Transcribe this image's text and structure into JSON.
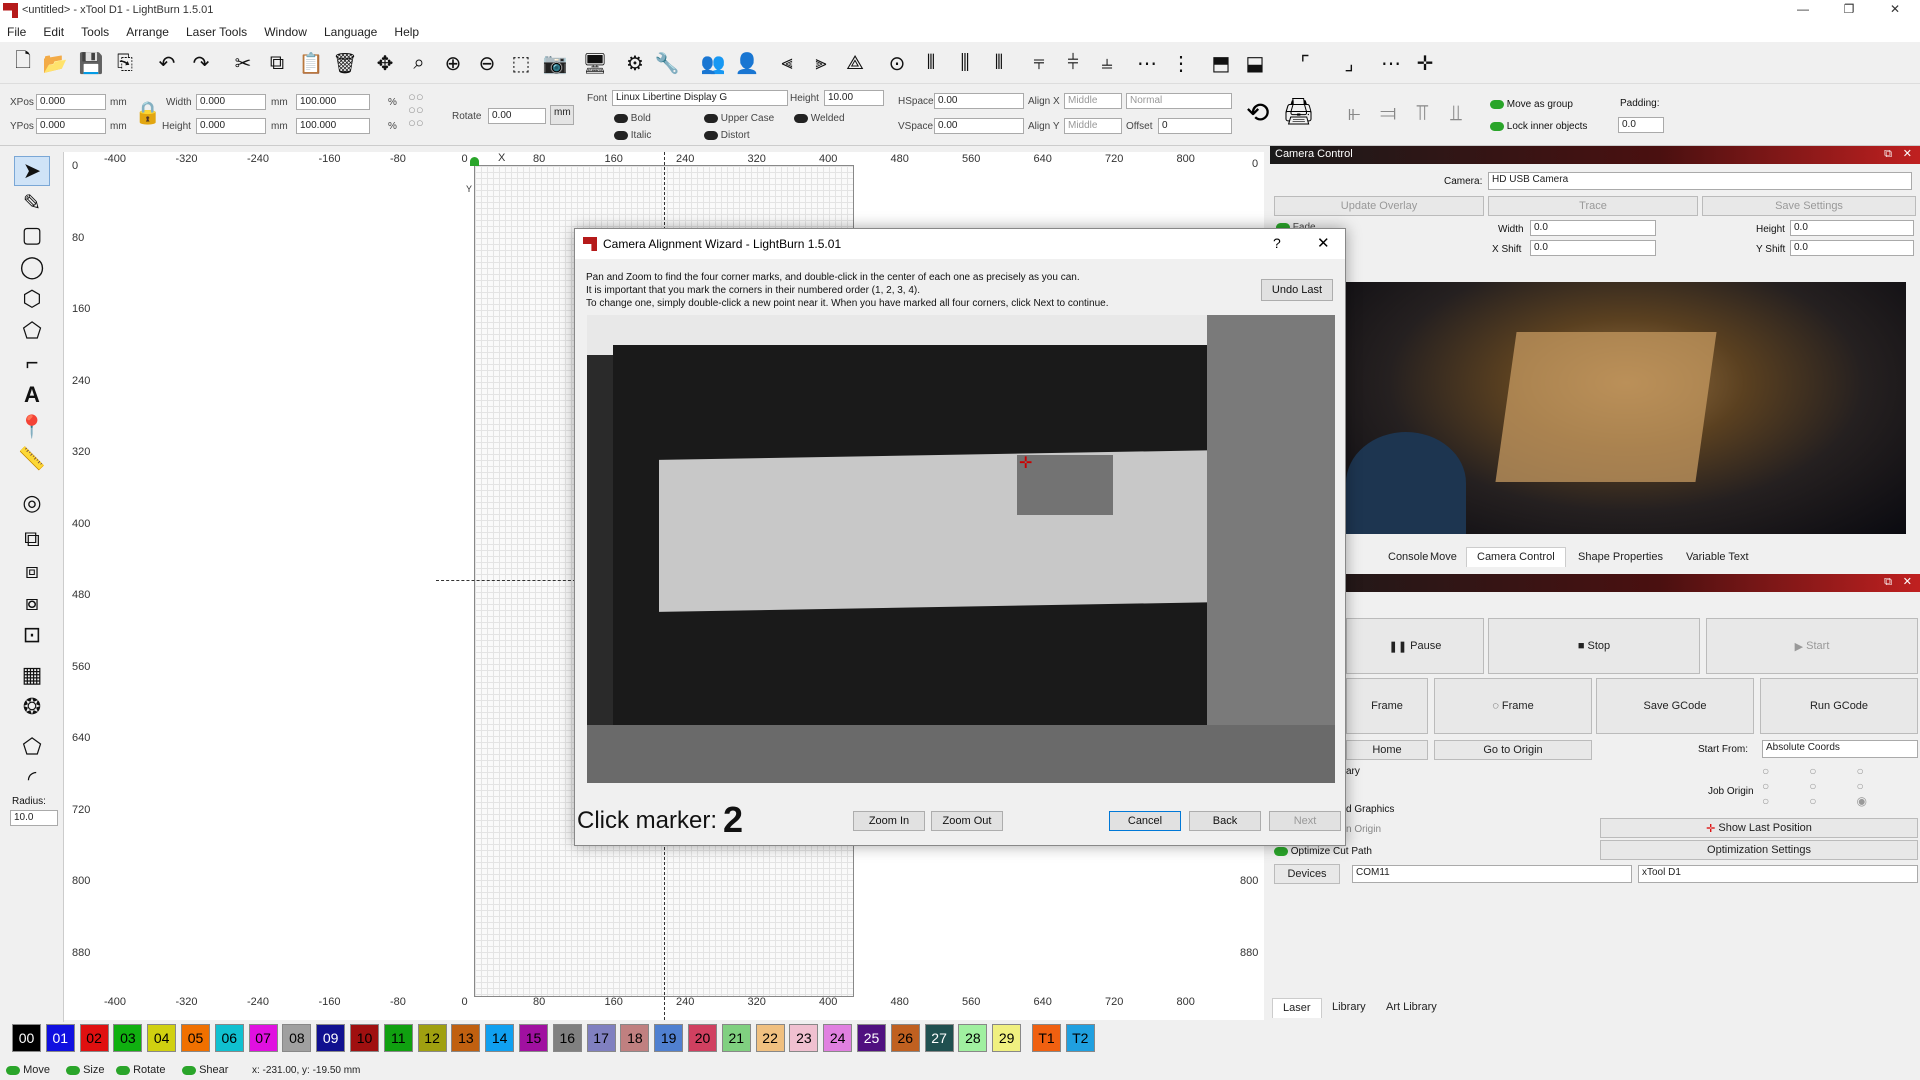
{
  "window": {
    "title": "<untitled> - xTool D1 - LightBurn 1.5.01",
    "minimize": "—",
    "restore": "❐",
    "close": "✕"
  },
  "menu": [
    "File",
    "Edit",
    "Tools",
    "Arrange",
    "Laser Tools",
    "Window",
    "Language",
    "Help"
  ],
  "props": {
    "xpos_label": "XPos",
    "xpos": "0.000",
    "ypos_label": "YPos",
    "ypos": "0.000",
    "unit": "mm",
    "width_label": "Width",
    "width": "0.000",
    "height_label": "Height",
    "height": "0.000",
    "scale_w": "100.000",
    "scale_h": "100.000",
    "pct": "%",
    "rotate_label": "Rotate",
    "rotate": "0.00",
    "mm_btn": "mm",
    "font_label": "Font",
    "font": "Linux Libertine Display G",
    "fheight_label": "Height",
    "fheight": "10.00",
    "hspace_label": "HSpace",
    "hspace": "0.00",
    "vspace_label": "VSpace",
    "vspace": "0.00",
    "alignx_label": "Align X",
    "alignx": "Middle",
    "aligny_label": "Align Y",
    "aligny": "Middle",
    "mode": "Normal",
    "offset_label": "Offset",
    "offset": "0",
    "bold": "Bold",
    "italic": "Italic",
    "upper": "Upper Case",
    "distort": "Distort",
    "welded": "Welded",
    "move_group": "Move as group",
    "lock_inner": "Lock inner objects",
    "padding_label": "Padding:",
    "padding": "0.0"
  },
  "left": {
    "radius_label": "Radius:",
    "radius": "10.0"
  },
  "rulers": {
    "top": [
      "-400",
      "-320",
      "-240",
      "-160",
      "-80",
      "0",
      "80",
      "160",
      "240",
      "320",
      "400",
      "480",
      "560",
      "640",
      "720",
      "800"
    ],
    "left": [
      "0",
      "80",
      "160",
      "240",
      "320",
      "400",
      "480",
      "560",
      "640",
      "720",
      "800",
      "880"
    ],
    "right": [
      "0",
      "800",
      "880"
    ],
    "x_axis": "X",
    "y_axis": "Y"
  },
  "camera": {
    "title": "Camera Control",
    "camera_label": "Camera:",
    "camera": "HD USB Camera",
    "update_overlay": "Update Overlay",
    "trace": "Trace",
    "save_settings": "Save Settings",
    "fade": "Fade",
    "width_label": "Width",
    "width": "0.0",
    "height_label": "Height",
    "height": "0.0",
    "xshift_label": "X Shift",
    "xshift": "0.0",
    "yshift_label": "Y Shift",
    "yshift": "0.0"
  },
  "tabs": [
    "Console",
    "Move",
    "Camera Control",
    "Shape Properties",
    "Variable Text"
  ],
  "laser": {
    "pause": "Pause",
    "stop": "Stop",
    "start": "Start",
    "frame1": "Frame",
    "frame2": "Frame",
    "save_gcode": "Save GCode",
    "run_gcode": "Run GCode",
    "home": "Home",
    "go_origin": "Go to Origin",
    "start_from_label": "Start From:",
    "start_from": "Absolute Coords",
    "ary": "ary",
    "job_origin": "Job Origin",
    "graphics": "d Graphics",
    "origin": "n Origin",
    "show_last": "Show Last Position",
    "opt_cut": "Optimize Cut Path",
    "opt_settings": "Optimization Settings",
    "devices": "Devices",
    "port": "COM11",
    "device": "xTool D1"
  },
  "bottom_tabs": [
    "Laser",
    "Library",
    "Art Library"
  ],
  "palette": [
    {
      "label": "00",
      "color": "#000000"
    },
    {
      "label": "01",
      "color": "#1010e0"
    },
    {
      "label": "02",
      "color": "#e01010"
    },
    {
      "label": "03",
      "color": "#10b010"
    },
    {
      "label": "04",
      "color": "#d0d010"
    },
    {
      "label": "05",
      "color": "#f07000"
    },
    {
      "label": "06",
      "color": "#10c0d0"
    },
    {
      "label": "07",
      "color": "#e010e0"
    },
    {
      "label": "08",
      "color": "#a0a0a0"
    },
    {
      "label": "09",
      "color": "#101090"
    },
    {
      "label": "10",
      "color": "#a01010"
    },
    {
      "label": "11",
      "color": "#10a010"
    },
    {
      "label": "12",
      "color": "#a0a010"
    },
    {
      "label": "13",
      "color": "#c06010"
    },
    {
      "label": "14",
      "color": "#10a0f0"
    },
    {
      "label": "15",
      "color": "#a010a0"
    },
    {
      "label": "16",
      "color": "#808080"
    },
    {
      "label": "17",
      "color": "#8080c0"
    },
    {
      "label": "18",
      "color": "#c08080"
    },
    {
      "label": "19",
      "color": "#5080d0"
    },
    {
      "label": "20",
      "color": "#d04060"
    },
    {
      "label": "21",
      "color": "#80d080"
    },
    {
      "label": "22",
      "color": "#f0c080"
    },
    {
      "label": "23",
      "color": "#f0c0d0"
    },
    {
      "label": "24",
      "color": "#e080e0"
    },
    {
      "label": "25",
      "color": "#501080"
    },
    {
      "label": "26",
      "color": "#c06020"
    },
    {
      "label": "27",
      "color": "#205050"
    },
    {
      "label": "28",
      "color": "#a0f0a0"
    },
    {
      "label": "29",
      "color": "#f0f080"
    },
    {
      "label": "T1",
      "color": "#f06010"
    },
    {
      "label": "T2",
      "color": "#20a0e0"
    }
  ],
  "status": {
    "move": "Move",
    "size": "Size",
    "rotate": "Rotate",
    "shear": "Shear",
    "coords": "x: -231.00, y: -19.50 mm"
  },
  "dialog": {
    "title": "Camera Alignment Wizard - LightBurn 1.5.01",
    "help": "?",
    "close": "✕",
    "line1": "Pan and Zoom to find the four corner marks, and double-click in the center of each one as precisely as you can.",
    "line2": "It is important that you mark the corners in their numbered order (1, 2, 3, 4).",
    "line3": "To change one, simply double-click a new point near it.  When you have marked all four corners, click Next to continue.",
    "undo": "Undo Last",
    "click_label": "Click marker:",
    "marker": "2",
    "zoom_in": "Zoom In",
    "zoom_out": "Zoom Out",
    "cancel": "Cancel",
    "back": "Back",
    "next": "Next"
  }
}
